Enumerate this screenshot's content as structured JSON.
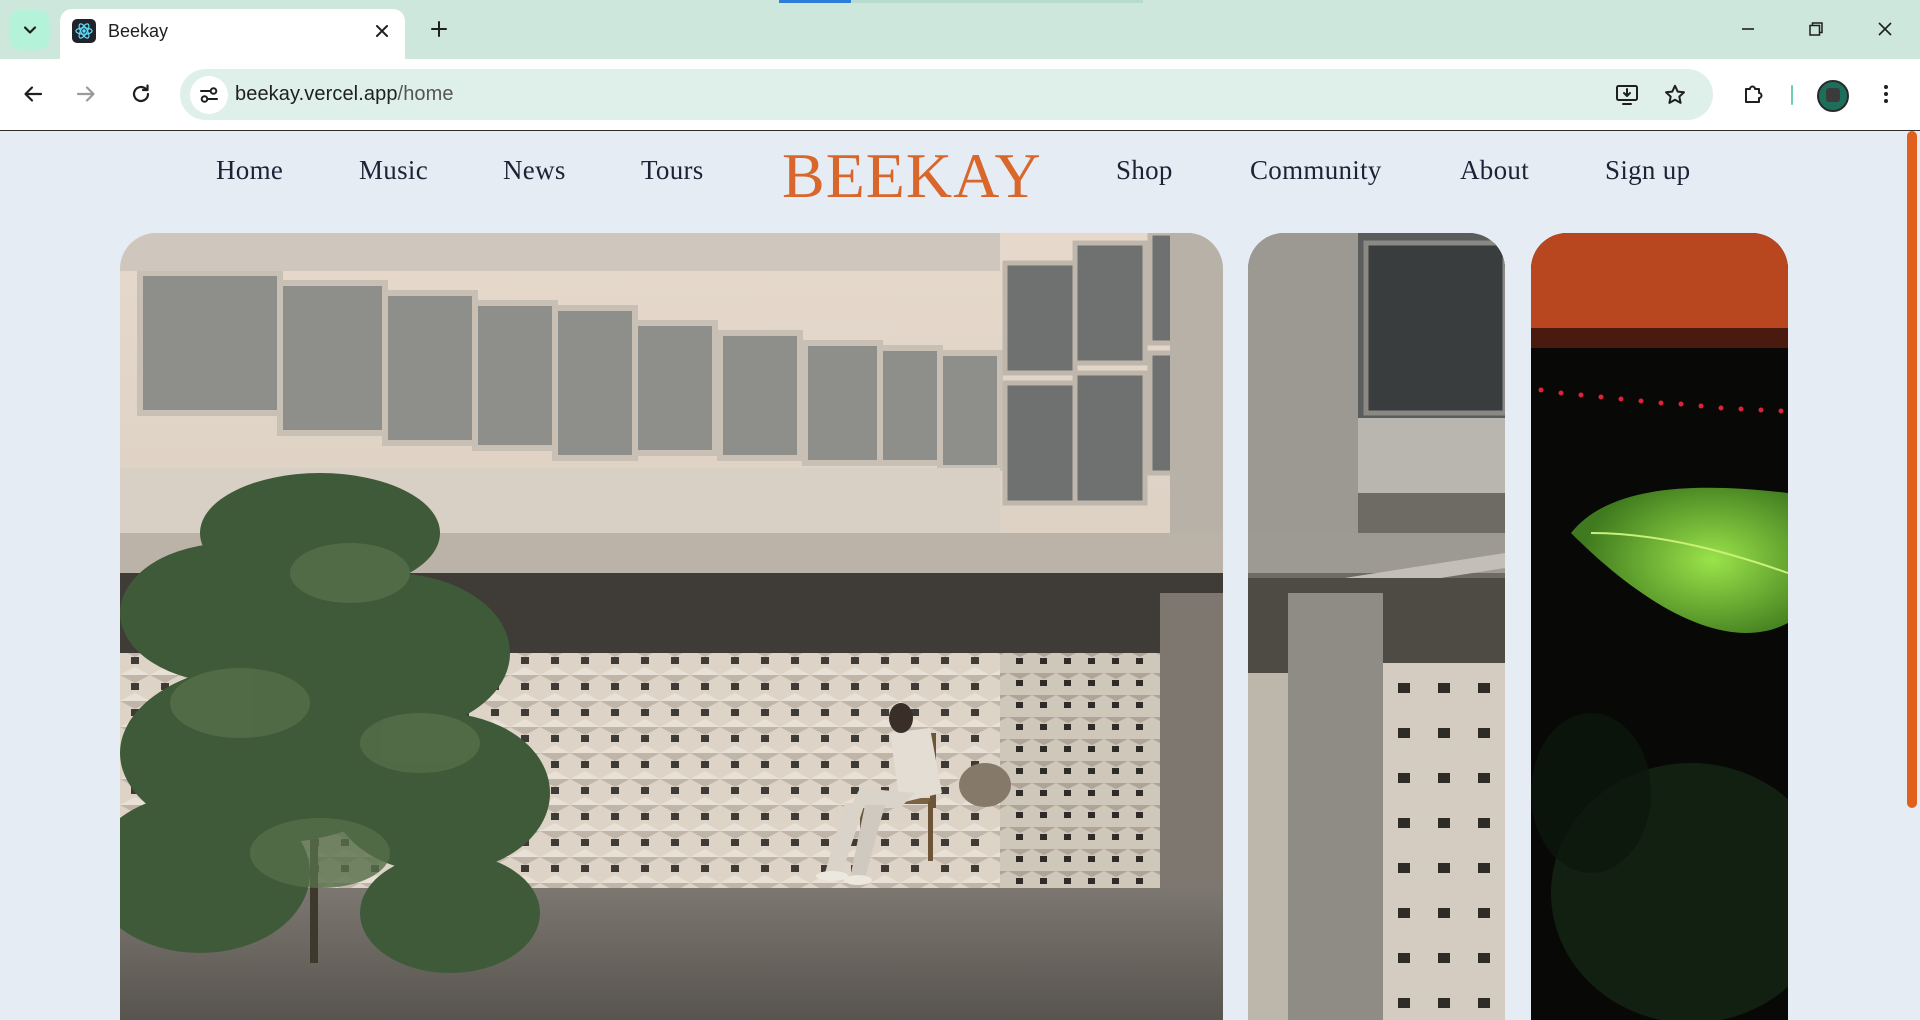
{
  "browser": {
    "tab": {
      "title": "Beekay",
      "favicon": "react-icon"
    },
    "address_bar": {
      "host": "beekay.vercel.app",
      "path": "/home"
    },
    "icons": [
      "chevron-down-icon",
      "close-icon",
      "plus-icon",
      "minimize-icon",
      "restore-icon",
      "back-arrow-icon",
      "forward-arrow-icon",
      "reload-icon",
      "site-settings-icon",
      "install-app-icon",
      "star-icon",
      "extensions-icon",
      "profile-avatar",
      "more-vert-icon"
    ]
  },
  "site": {
    "logo": "BEEKAY",
    "nav_left": [
      "Home",
      "Music",
      "News",
      "Tours"
    ],
    "nav_right": [
      "Shop",
      "Community",
      "About",
      "Sign up"
    ]
  },
  "colors": {
    "brand_orange": "#d9662a",
    "nav_text": "#1b2436",
    "page_bg": "#e5ecf3",
    "tabstrip_bg": "#cde7dc",
    "omnibox_bg": "#dff0ea",
    "scrollbar": "#e0601c"
  }
}
